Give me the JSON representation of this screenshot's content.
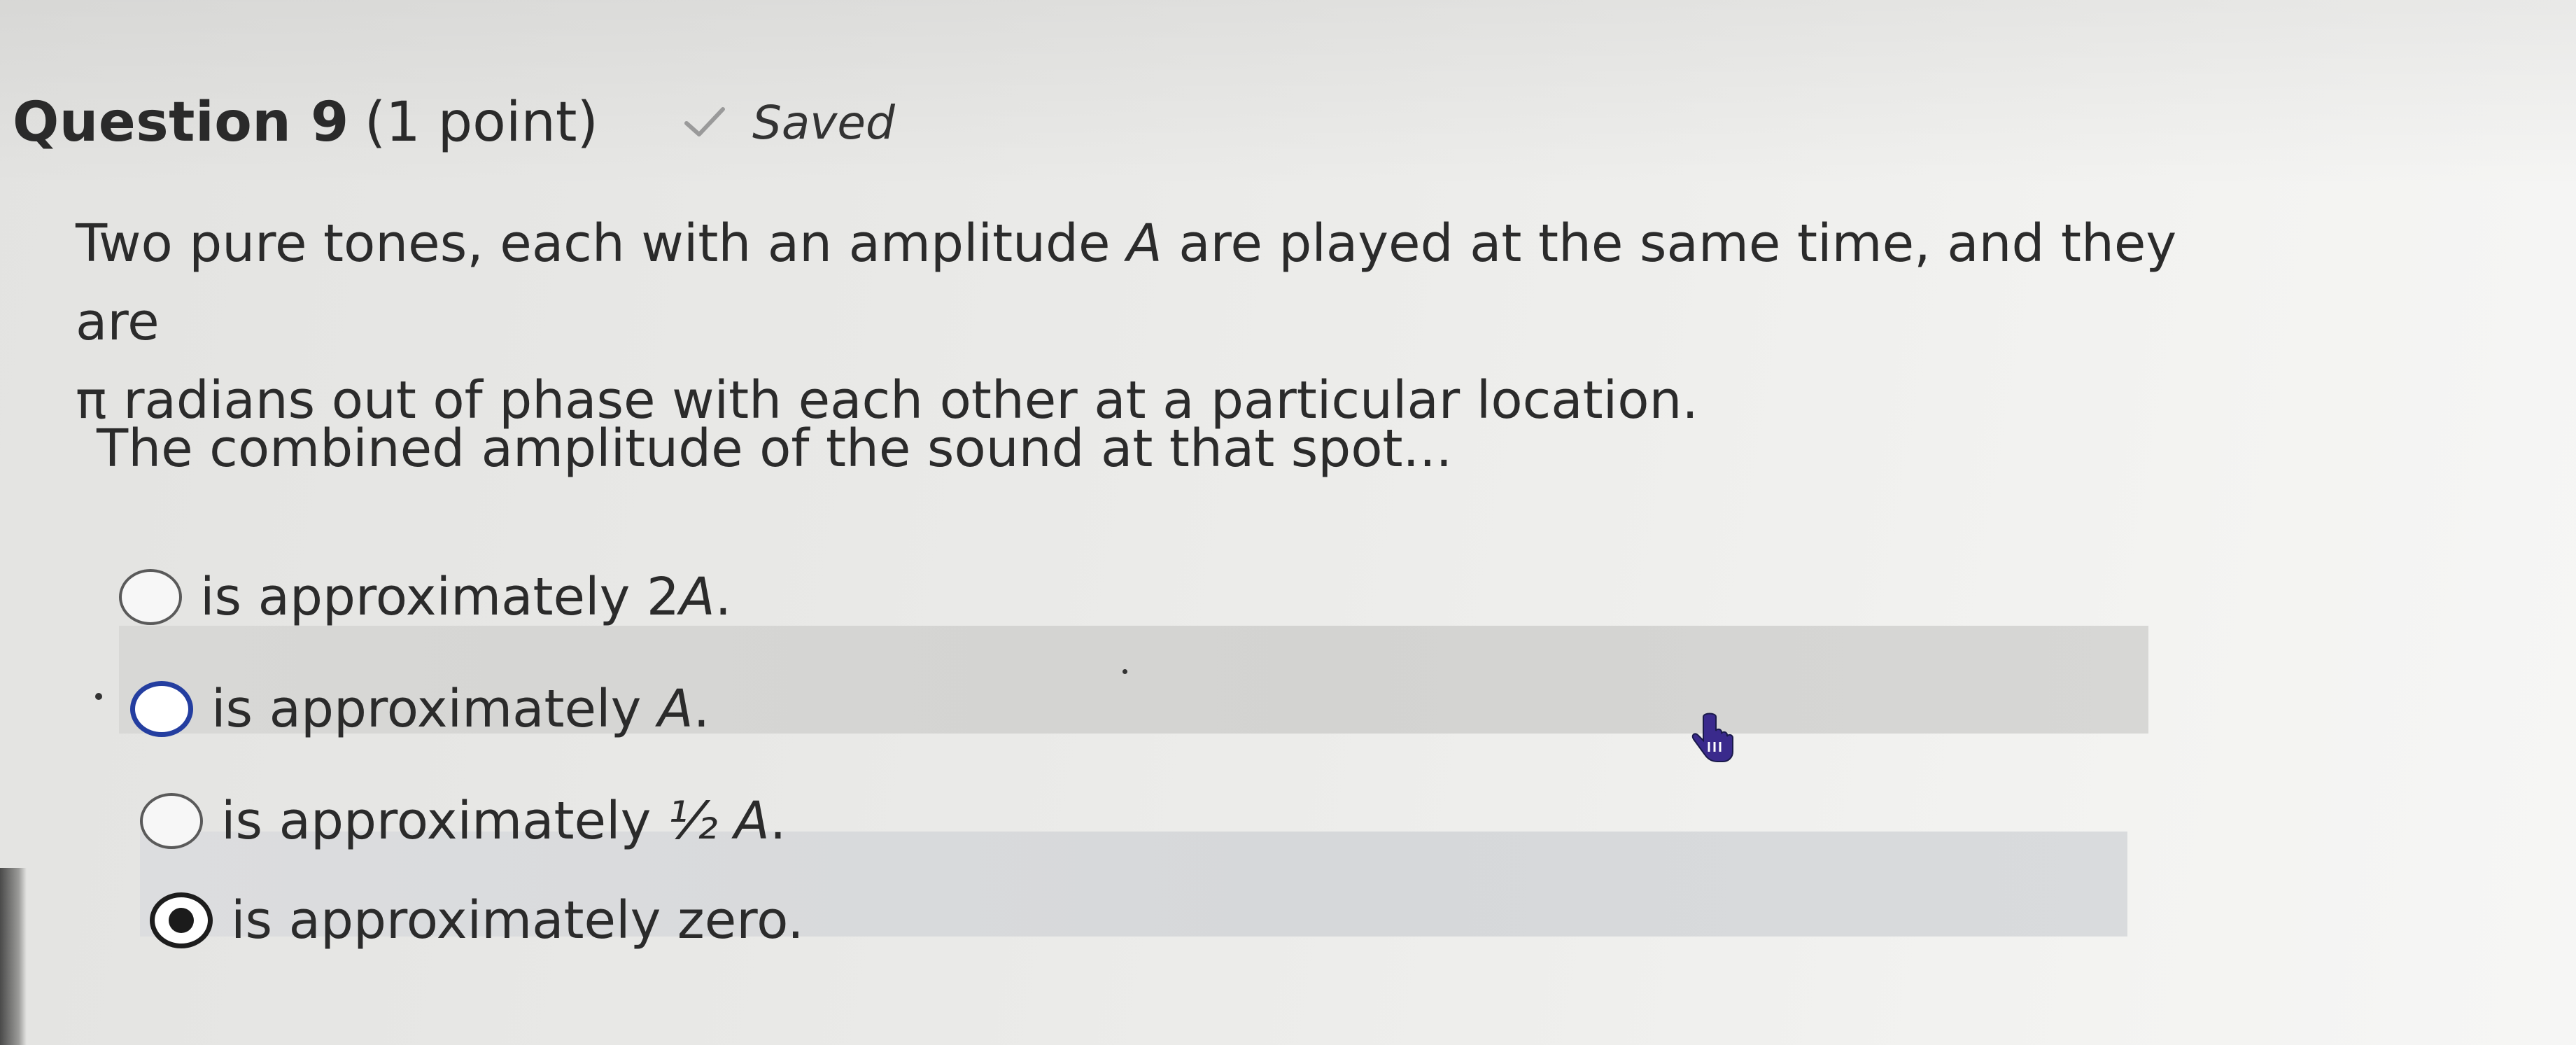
{
  "question": {
    "title": "Question 9",
    "points": "(1 point)",
    "status": "Saved",
    "status_icon": "check-icon"
  },
  "body": {
    "line1_start": "Two pure tones, each with an amplitude ",
    "line1_symbol": "A",
    "line1_end": " are played at the same time, and they are",
    "line2": "π radians out of phase with each other at a particular location.",
    "prompt": "The combined amplitude of the sound at that spot..."
  },
  "choices": [
    {
      "text": "is approximately 2",
      "symbol": "A",
      "suffix": ".",
      "selected": false
    },
    {
      "text": "is approximately ",
      "symbol": "A",
      "suffix": ".",
      "selected": false
    },
    {
      "text": "is approximately ",
      "symbol": "½ A",
      "suffix": ".",
      "selected": false
    },
    {
      "text": "is approximately zero.",
      "symbol": "",
      "suffix": "",
      "selected": true
    }
  ],
  "colors": {
    "focus_ring": "#243ea0",
    "hover_row": "#d6d6d4",
    "selected_row": "#d8dadc"
  }
}
